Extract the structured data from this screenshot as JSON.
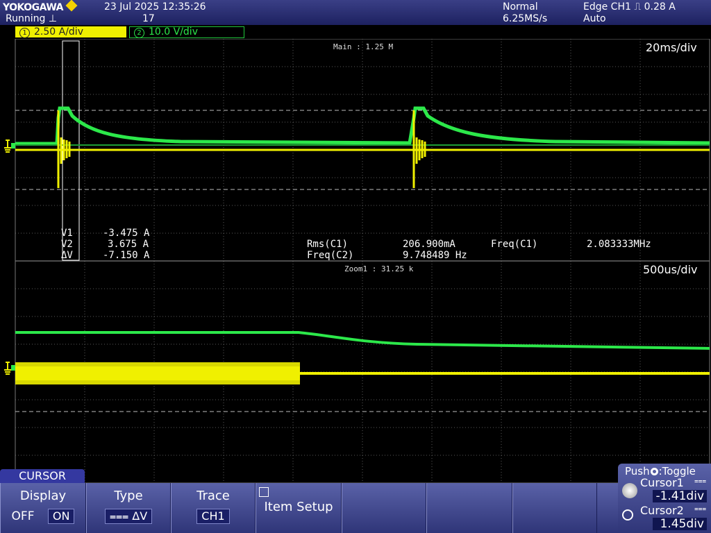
{
  "header": {
    "brand": "YOKOGAWA",
    "date_time": "23 Jul 2025 12:35:26",
    "run_state": "Running",
    "acq_count": "17",
    "mode": "Normal",
    "sample_rate": "6.25MS/s",
    "trigger": "Edge CH1",
    "trigger_level": "0.28 A",
    "trigger_mode": "Auto"
  },
  "channels": [
    {
      "num": "1",
      "scale": "2.50 A/div",
      "color": "#f0f000"
    },
    {
      "num": "2",
      "scale": "10.0 V/div",
      "color": "#2ce84a"
    }
  ],
  "main": {
    "label": "Main : 1.25 M",
    "timebase": "20ms/div"
  },
  "zoom": {
    "label": "Zoom1 : 31.25 k",
    "timebase": "500us/div"
  },
  "cursor_readout": {
    "v1_label": "V1",
    "v1": "-3.475 A",
    "v2_label": "V2",
    "v2": "3.675 A",
    "dv_label": "ΔV",
    "dv": "-7.150 A"
  },
  "measurements": {
    "rms_label": "Rms(C1)",
    "rms": "206.900mA",
    "freq2_label": "Freq(C2)",
    "freq2": "9.748489 Hz",
    "freq1_label": "Freq(C1)",
    "freq1": "2.083333MHz"
  },
  "softkeys": {
    "menu_title": "CURSOR",
    "display_label": "Display",
    "display_off": "OFF",
    "display_on": "ON",
    "type_label": "Type",
    "type_value": "ΔV",
    "trace_label": "Trace",
    "trace_value": "CH1",
    "item_setup_label": "Item Setup"
  },
  "knob": {
    "push_label": "Push",
    "toggle_label": ":Toggle",
    "cursor1_label": "Cursor1",
    "cursor1_value": "-1.41div",
    "cursor2_label": "Cursor2",
    "cursor2_value": "1.45div"
  },
  "colors": {
    "ch1": "#f0f000",
    "ch2": "#2ce84a",
    "grid": "#5a5a5a"
  }
}
